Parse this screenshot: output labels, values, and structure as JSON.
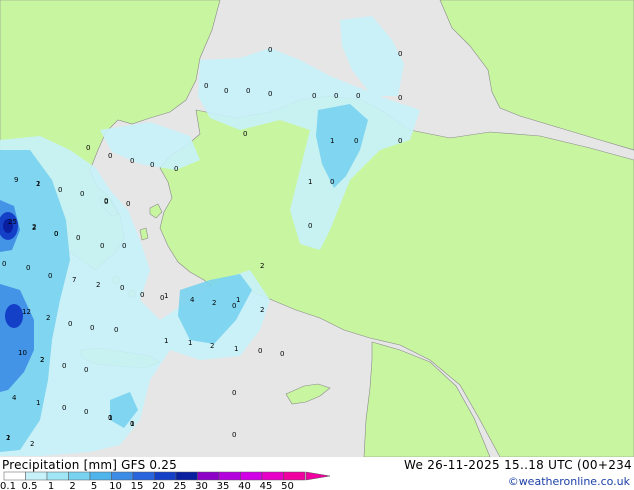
{
  "map": {
    "point_values": [
      {
        "v": "0"
      },
      {
        "v": "0"
      },
      {
        "v": "0"
      },
      {
        "v": "0"
      },
      {
        "v": "0"
      },
      {
        "v": "0"
      },
      {
        "v": "0"
      },
      {
        "v": "0"
      },
      {
        "v": "0"
      },
      {
        "v": "0"
      },
      {
        "v": "0"
      },
      {
        "v": "1"
      },
      {
        "v": "0"
      },
      {
        "v": "0"
      },
      {
        "v": "0"
      },
      {
        "v": "0"
      },
      {
        "v": "0"
      },
      {
        "v": "0"
      },
      {
        "v": "0"
      },
      {
        "v": "1"
      },
      {
        "v": "0"
      },
      {
        "v": "2"
      },
      {
        "v": "0"
      },
      {
        "v": "0"
      },
      {
        "v": "0"
      },
      {
        "v": "0"
      },
      {
        "v": "0"
      },
      {
        "v": "0"
      },
      {
        "v": "0"
      },
      {
        "v": "0"
      },
      {
        "v": "0"
      },
      {
        "v": "2"
      },
      {
        "v": "0"
      },
      {
        "v": "0"
      },
      {
        "v": "0"
      },
      {
        "v": "9"
      },
      {
        "v": "1"
      },
      {
        "v": "0"
      },
      {
        "v": "2"
      },
      {
        "v": "0"
      },
      {
        "v": "25"
      },
      {
        "v": "2"
      },
      {
        "v": "0"
      },
      {
        "v": "0"
      },
      {
        "v": "0"
      },
      {
        "v": "1"
      },
      {
        "v": "4"
      },
      {
        "v": "2"
      },
      {
        "v": "7"
      },
      {
        "v": "2"
      },
      {
        "v": "0"
      },
      {
        "v": "1"
      },
      {
        "v": "2"
      },
      {
        "v": "2"
      },
      {
        "v": "0"
      },
      {
        "v": "0"
      },
      {
        "v": "0"
      },
      {
        "v": "12"
      },
      {
        "v": "2"
      },
      {
        "v": "0"
      },
      {
        "v": "0"
      },
      {
        "v": "1"
      },
      {
        "v": "1"
      },
      {
        "v": "2"
      },
      {
        "v": "1"
      },
      {
        "v": "0"
      },
      {
        "v": "0"
      },
      {
        "v": "10"
      },
      {
        "v": "2"
      },
      {
        "v": "0"
      },
      {
        "v": "4"
      },
      {
        "v": "1"
      },
      {
        "v": "0"
      },
      {
        "v": "0"
      },
      {
        "v": "0"
      },
      {
        "v": "0"
      },
      {
        "v": "1"
      },
      {
        "v": "1"
      },
      {
        "v": "1"
      },
      {
        "v": "0"
      },
      {
        "v": "2"
      },
      {
        "v": "2"
      }
    ]
  },
  "footer": {
    "title": "Precipitation [mm]  GFS 0.25",
    "timestamp": "We 26-11-2025 15..18 UTC (00+234",
    "credit": "©weatheronline.co.uk"
  },
  "scale": {
    "labels": [
      "0.1",
      "0.5",
      "1",
      "2",
      "5",
      "10",
      "15",
      "20",
      "25",
      "30",
      "35",
      "40",
      "45",
      "50"
    ],
    "colors": [
      "#fefefe",
      "#c8f2fa",
      "#a0e6f5",
      "#78d2f0",
      "#50b4ec",
      "#3c8ce6",
      "#2864dc",
      "#1440c8",
      "#0a1ea0",
      "#8c00c8",
      "#b400dc",
      "#d200e6",
      "#e600c8",
      "#f000a0"
    ]
  },
  "colors": {
    "sea": "#e6e6e6",
    "land": "#c8f5a0",
    "precip_light": "#c8f2fa",
    "precip_mid": "#78d2f0",
    "precip_heavy": "#2864dc",
    "credit": "#1c3fa8"
  }
}
